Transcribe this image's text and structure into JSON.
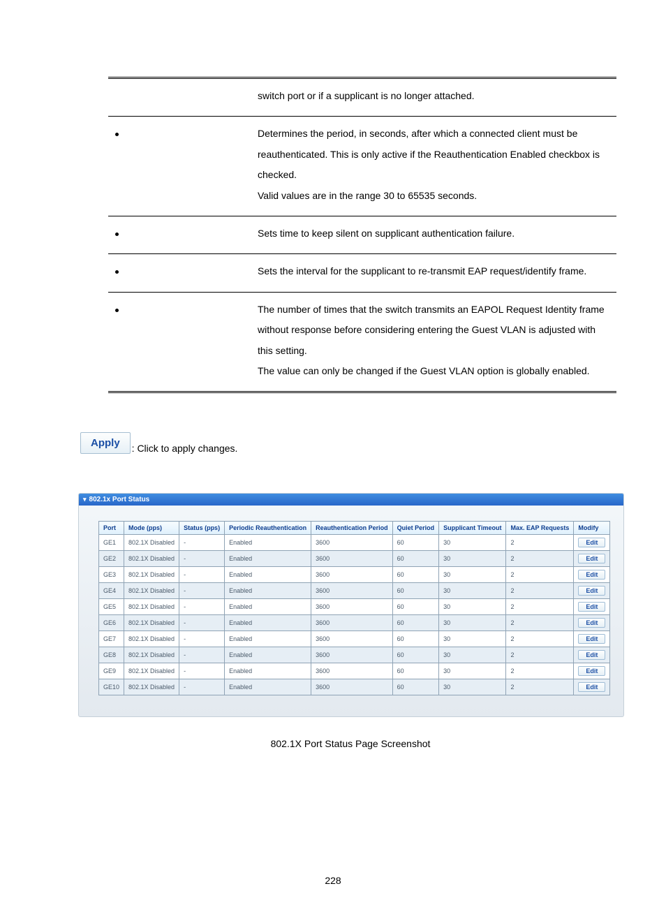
{
  "desc_rows": [
    {
      "bullet": false,
      "text": "switch port or if a supplicant is no longer attached."
    },
    {
      "bullet": true,
      "text": "Determines the period, in seconds, after which a connected client must be reauthenticated. This is only active if the Reauthentication Enabled checkbox is checked.\nValid values are in the range 30 to 65535 seconds."
    },
    {
      "bullet": true,
      "text": "Sets time to keep silent on supplicant authentication failure."
    },
    {
      "bullet": true,
      "text": "Sets the interval for the supplicant to re-transmit EAP request/identify frame."
    },
    {
      "bullet": true,
      "text": "The number of times that the switch transmits an EAPOL Request Identity frame without response before considering entering the Guest VLAN is adjusted with this setting.\nThe value can only be changed if the Guest VLAN option is globally enabled."
    }
  ],
  "apply": {
    "label": "Apply",
    "text": ": Click to apply changes."
  },
  "panel_title": "802.1x Port Status",
  "headers": [
    "Port",
    "Mode (pps)",
    "Status (pps)",
    "Periodic Reauthentication",
    "Reauthentication Period",
    "Quiet Period",
    "Supplicant Timeout",
    "Max. EAP Requests",
    "Modify"
  ],
  "rows": [
    {
      "port": "GE1",
      "mode": "802.1X Disabled",
      "status": "-",
      "periodic": "Enabled",
      "reauth": "3600",
      "quiet": "60",
      "supp": "30",
      "max": "2"
    },
    {
      "port": "GE2",
      "mode": "802.1X Disabled",
      "status": "-",
      "periodic": "Enabled",
      "reauth": "3600",
      "quiet": "60",
      "supp": "30",
      "max": "2"
    },
    {
      "port": "GE3",
      "mode": "802.1X Disabled",
      "status": "-",
      "periodic": "Enabled",
      "reauth": "3600",
      "quiet": "60",
      "supp": "30",
      "max": "2"
    },
    {
      "port": "GE4",
      "mode": "802.1X Disabled",
      "status": "-",
      "periodic": "Enabled",
      "reauth": "3600",
      "quiet": "60",
      "supp": "30",
      "max": "2"
    },
    {
      "port": "GE5",
      "mode": "802.1X Disabled",
      "status": "-",
      "periodic": "Enabled",
      "reauth": "3600",
      "quiet": "60",
      "supp": "30",
      "max": "2"
    },
    {
      "port": "GE6",
      "mode": "802.1X Disabled",
      "status": "-",
      "periodic": "Enabled",
      "reauth": "3600",
      "quiet": "60",
      "supp": "30",
      "max": "2"
    },
    {
      "port": "GE7",
      "mode": "802.1X Disabled",
      "status": "-",
      "periodic": "Enabled",
      "reauth": "3600",
      "quiet": "60",
      "supp": "30",
      "max": "2"
    },
    {
      "port": "GE8",
      "mode": "802.1X Disabled",
      "status": "-",
      "periodic": "Enabled",
      "reauth": "3600",
      "quiet": "60",
      "supp": "30",
      "max": "2"
    },
    {
      "port": "GE9",
      "mode": "802.1X Disabled",
      "status": "-",
      "periodic": "Enabled",
      "reauth": "3600",
      "quiet": "60",
      "supp": "30",
      "max": "2"
    },
    {
      "port": "GE10",
      "mode": "802.1X Disabled",
      "status": "-",
      "periodic": "Enabled",
      "reauth": "3600",
      "quiet": "60",
      "supp": "30",
      "max": "2"
    }
  ],
  "edit_label": "Edit",
  "caption": "802.1X Port Status Page Screenshot",
  "page_number": "228"
}
